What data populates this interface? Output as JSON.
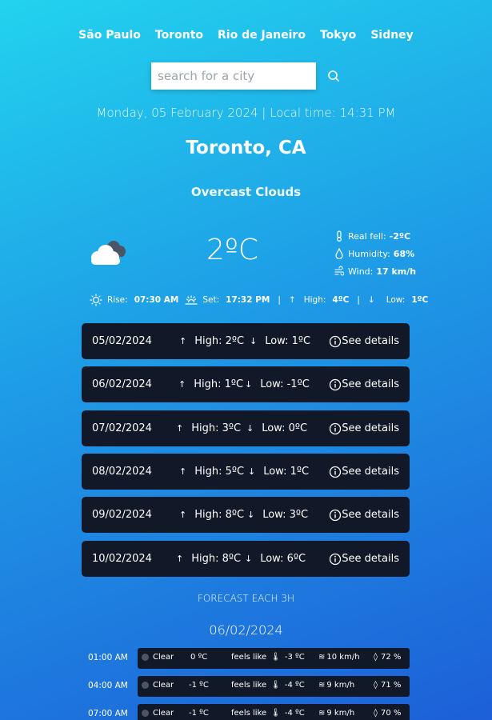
{
  "nav": {
    "cities": [
      "São Paulo",
      "Toronto",
      "Rio de Janeiro",
      "Tokyo",
      "Sidney"
    ]
  },
  "search": {
    "placeholder": "search for a city",
    "icon": "search-icon"
  },
  "current": {
    "datetime": "Monday, 05 February 2024 | Local time: 14:31 PM",
    "city": "Toronto, CA",
    "condition": "Overcast Clouds",
    "icon": "overcast-clouds-icon",
    "temperature": "2ºC",
    "real_feel_label": "Real fell:",
    "real_feel_value": "-2ºC",
    "humidity_label": "Humidity:",
    "humidity_value": "68%",
    "wind_label": "Wind:",
    "wind_value": "17 km/h",
    "rise_label": "Rise:",
    "rise_value": "07:30 AM",
    "set_label": "Set:",
    "set_value": "17:32 PM",
    "separator": "|",
    "high_label": "High:",
    "high_value": "4ºC",
    "low_label": "Low:",
    "low_value": "1ºC"
  },
  "daily": [
    {
      "date": "05/02/2024",
      "high": "High: 2ºC",
      "low": "Low: 1ºC",
      "details": "See details"
    },
    {
      "date": "06/02/2024",
      "high": "High: 1ºC",
      "low": "Low: -1ºC",
      "details": "See details"
    },
    {
      "date": "07/02/2024",
      "high": "High: 3ºC",
      "low": "Low: 0ºC",
      "details": "See details"
    },
    {
      "date": "08/02/2024",
      "high": "High: 5ºC",
      "low": "Low: 1ºC",
      "details": "See details"
    },
    {
      "date": "09/02/2024",
      "high": "High: 8ºC",
      "low": "Low: 3ºC",
      "details": "See details"
    },
    {
      "date": "10/02/2024",
      "high": "High: 8ºC",
      "low": "Low: 6ºC",
      "details": "See details"
    }
  ],
  "hourly": {
    "section_title": "FORECAST EACH 3H",
    "day": "06/02/2024",
    "feels_label": "feels like",
    "rows": [
      {
        "time": "01:00 AM",
        "condition": "Clear",
        "temp": "0 ºC",
        "feels": "-3 ºC",
        "wind": "10 km/h",
        "humidity": "72 %"
      },
      {
        "time": "04:00 AM",
        "condition": "Clear",
        "temp": "-1 ºC",
        "feels": "-4 ºC",
        "wind": "9 km/h",
        "humidity": "71 %"
      },
      {
        "time": "07:00 AM",
        "condition": "Clear",
        "temp": "-1 ºC",
        "feels": "-4 ºC",
        "wind": "9 km/h",
        "humidity": "70 %"
      }
    ]
  },
  "colors": {
    "card": "#111827",
    "bg_start": "#22d3ee",
    "bg_end": "#1d5fd8"
  }
}
